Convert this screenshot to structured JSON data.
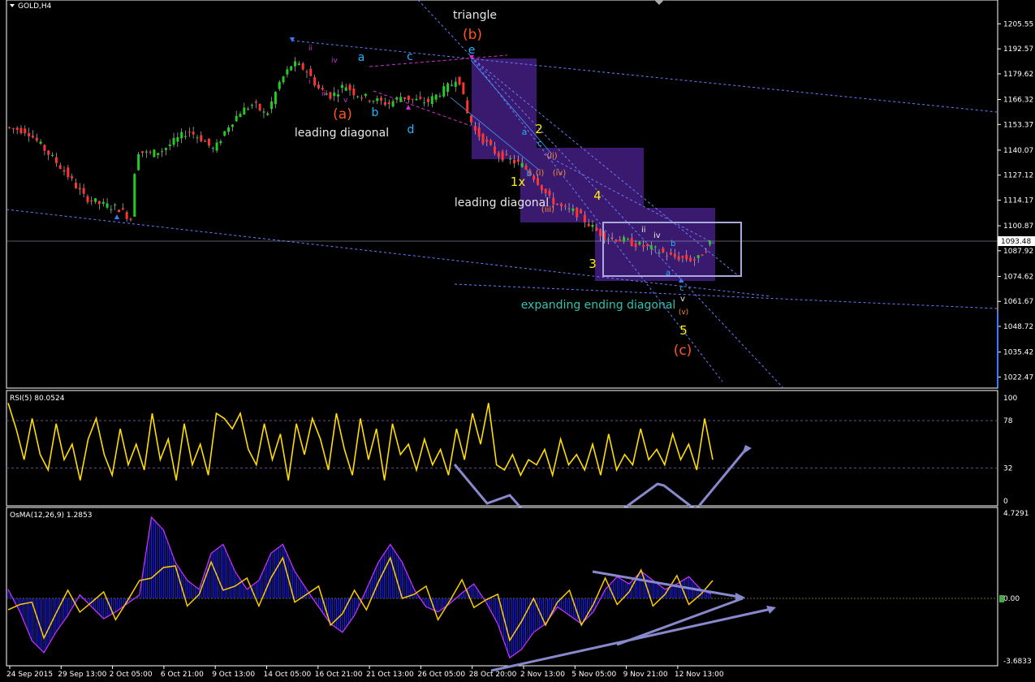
{
  "window": {
    "symbol_label": "GOLD,H4",
    "rsi_label": "RSI(5) 80.0524",
    "osma_label": "OsMA(12,26,9) 1.2853"
  },
  "colors": {
    "background": "#000000",
    "grid_border": "#ffffff",
    "bull": "#22cc22",
    "bear": "#ff3333",
    "channel": "#6a7cff",
    "box": "#a9a9dd",
    "zone": "#3a1a6e",
    "rsi_line": "#ffdd00",
    "osma_fill": "#2020ff",
    "osma_signal": "#ffcc00",
    "osma_edge": "#cc33ff",
    "arrow": "#8888cc",
    "wave_orange": "#ff5522",
    "wave_yellow": "#ffee00",
    "wave_cyan": "#22b4ff",
    "wave_magenta": "#cc33cc",
    "label_white": "#e6e6e6",
    "label_teal": "#33c0b0"
  },
  "chart_data": [
    {
      "type": "candlestick",
      "title": "GOLD,H4",
      "ylim": [
        1018,
        1212
      ],
      "y_ticks": [
        "1205.55",
        "1192.57",
        "1179.62",
        "1166.32",
        "1153.37",
        "1140.07",
        "1127.12",
        "1114.17",
        "1100.87",
        "1087.92",
        "1074.62",
        "1061.67",
        "1048.72",
        "1035.42",
        "1022.47"
      ],
      "current_price": "1093.48",
      "x_ticks": [
        "24 Sep 2015",
        "29 Sep 13:00",
        "2 Oct 05:00",
        "6 Oct 21:00",
        "9 Oct 13:00",
        "14 Oct 05:00",
        "16 Oct 21:00",
        "21 Oct 13:00",
        "26 Oct 05:00",
        "28 Oct 20:00",
        "2 Nov 13:00",
        "5 Nov 05:00",
        "9 Nov 21:00",
        "12 Nov 13:00"
      ],
      "price_path": [
        [
          0,
          1152
        ],
        [
          5,
          1150
        ],
        [
          10,
          1138
        ],
        [
          14,
          1128
        ],
        [
          18,
          1116
        ],
        [
          22,
          1112
        ],
        [
          26,
          1110
        ],
        [
          29,
          1104
        ],
        [
          30,
          1140
        ],
        [
          33,
          1138
        ],
        [
          36,
          1140
        ],
        [
          39,
          1145
        ],
        [
          42,
          1150
        ],
        [
          45,
          1146
        ],
        [
          48,
          1140
        ],
        [
          51,
          1152
        ],
        [
          54,
          1160
        ],
        [
          57,
          1164
        ],
        [
          60,
          1158
        ],
        [
          63,
          1175
        ],
        [
          66,
          1185
        ],
        [
          69,
          1182
        ],
        [
          72,
          1172
        ],
        [
          75,
          1168
        ],
        [
          78,
          1174
        ],
        [
          80,
          1170
        ],
        [
          82,
          1168
        ],
        [
          85,
          1166
        ],
        [
          88,
          1164
        ],
        [
          91,
          1168
        ],
        [
          94,
          1166
        ],
        [
          97,
          1165
        ],
        [
          100,
          1170
        ],
        [
          103,
          1175
        ],
        [
          104,
          1180
        ],
        [
          106,
          1160
        ],
        [
          108,
          1150
        ],
        [
          110,
          1145
        ],
        [
          113,
          1138
        ],
        [
          116,
          1135
        ],
        [
          119,
          1132
        ],
        [
          122,
          1125
        ],
        [
          125,
          1115
        ],
        [
          128,
          1110
        ],
        [
          131,
          1108
        ],
        [
          134,
          1102
        ],
        [
          136,
          1098
        ],
        [
          138,
          1095
        ],
        [
          141,
          1094
        ],
        [
          144,
          1092
        ],
        [
          147,
          1090
        ],
        [
          150,
          1088
        ],
        [
          153,
          1085
        ],
        [
          156,
          1084
        ],
        [
          159,
          1083
        ],
        [
          162,
          1092
        ]
      ],
      "annotations": [
        "triangle",
        "(b)",
        "e",
        "a",
        "c",
        "(a)",
        "b",
        "d",
        "i",
        "ii",
        "iii",
        "iv",
        "v",
        "leading diagonal",
        "2",
        "1x",
        "a",
        "b",
        "c",
        "(i)",
        "(ii)",
        "(iii)",
        "(iv)",
        "4",
        "3",
        "ii",
        "iv",
        "expanding ending diagonal",
        "5",
        "(c)",
        "v",
        "(v)"
      ]
    },
    {
      "type": "line",
      "title": "RSI(5) 80.0524",
      "ylim": [
        0,
        100
      ],
      "y_ticks": [
        "100",
        "78",
        "32",
        "0"
      ],
      "levels": [
        78,
        32
      ],
      "values": [
        95,
        70,
        40,
        80,
        45,
        30,
        75,
        40,
        55,
        20,
        60,
        80,
        45,
        25,
        70,
        35,
        55,
        30,
        85,
        40,
        60,
        20,
        75,
        35,
        55,
        25,
        85,
        80,
        70,
        85,
        50,
        35,
        75,
        40,
        65,
        20,
        75,
        45,
        80,
        60,
        30,
        85,
        50,
        25,
        80,
        40,
        70,
        20,
        75,
        45,
        55,
        30,
        60,
        35,
        50,
        25,
        70,
        40,
        85,
        55,
        95,
        35,
        30,
        45,
        25,
        40,
        35,
        50,
        25,
        60,
        35,
        45,
        30,
        55,
        25,
        65,
        30,
        45,
        35,
        70,
        40,
        50,
        35,
        65,
        40,
        55,
        30,
        80,
        40
      ]
    },
    {
      "type": "area",
      "title": "OsMA(12,26,9) 1.2853",
      "ylim": [
        -3.6833,
        4.7291
      ],
      "y_ticks": [
        "4.7291",
        "0.00",
        "-3.6833"
      ],
      "values": [
        0.5,
        -0.8,
        -2.5,
        -3.2,
        -2.0,
        -1.0,
        0.2,
        -0.5,
        -1.2,
        -0.8,
        -0.3,
        0.2,
        4.5,
        3.8,
        2.0,
        1.0,
        0.5,
        2.5,
        3.0,
        1.5,
        0.5,
        1.0,
        2.5,
        3.0,
        1.5,
        0.5,
        -0.5,
        -1.5,
        -2.0,
        -1.0,
        0.5,
        2.0,
        3.0,
        2.0,
        0.5,
        -0.5,
        -0.8,
        -0.3,
        0.3,
        0.8,
        -0.2,
        -1.5,
        -3.5,
        -3.0,
        -2.0,
        -1.5,
        -0.5,
        -1.0,
        -1.5,
        -0.8,
        0.5,
        1.2,
        0.8,
        1.5,
        1.0,
        0.5,
        0.8,
        1.2,
        0.5,
        0.2
      ]
    }
  ]
}
